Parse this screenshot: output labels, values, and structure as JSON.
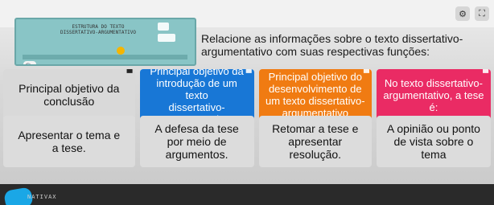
{
  "top_icons": [
    {
      "name": "settings-icon",
      "glyph": "⚙"
    },
    {
      "name": "fullscreen-icon",
      "glyph": "⛶"
    }
  ],
  "thumbnail": {
    "title": "ESTRUTURA DO TEXTO\nDISSERTATIVO-ARGUMENTATIVO",
    "search_glyph": "🔍"
  },
  "question": {
    "text": "Relacione as informações sobre o texto dissertativo-\nargumentativo com suas respectivas funções:"
  },
  "items": [
    {
      "text": "Principal objetivo da\nconclusão",
      "color": "#d9d9d9",
      "text_color": "#111111",
      "has_handle": true,
      "handle_glyph": "▀"
    },
    {
      "text": "Principal objetivo da\nintrodução de um texto\ndissertativo-\nargumentativo",
      "color": "#1877d6",
      "text_color": "#ffffff",
      "has_handle": true,
      "handle_glyph": "▀"
    },
    {
      "text": "Principal objetivo do\ndesenvolvimento de\num texto dissertativo-\nargumentativo",
      "color": "#f07b12",
      "text_color": "#ffffff",
      "has_handle": true,
      "handle_glyph": "▀"
    },
    {
      "text": "No texto dissertativo-\nargumentativo, a tese\né:",
      "color": "#ea2b64",
      "text_color": "#ffffff",
      "has_handle": true,
      "handle_glyph": "▀"
    }
  ],
  "answers": [
    {
      "text": "Apresentar o tema e\na tese."
    },
    {
      "text": "A defesa da tese\npor meio de\nargumentos."
    },
    {
      "text": "Retomar a tese e\napresentar\nresolução."
    },
    {
      "text": "A opinião ou ponto\nde vista sobre o\ntema"
    }
  ],
  "bottom": {
    "label": "NATIVAX"
  }
}
